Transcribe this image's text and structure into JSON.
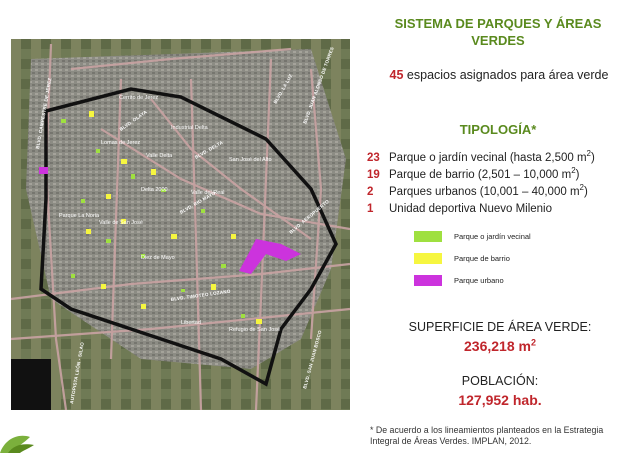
{
  "title": "SISTEMA DE PARQUES Y ÁREAS VERDES",
  "spaces": {
    "count": "45",
    "text": "espacios asignados para área verde"
  },
  "tipologia_title": "TIPOLOGÍA*",
  "types": [
    {
      "count": "23",
      "label": "Parque o jardín vecinal (hasta 2,500 m",
      "sup": "2",
      "close": ")"
    },
    {
      "count": "19",
      "label": "Parque de barrio (2,501 – 10,000 m",
      "sup": "2",
      "close": ")"
    },
    {
      "count": "2",
      "label": "Parques urbanos (10,001 – 40,000 m",
      "sup": "2",
      "close": ")"
    },
    {
      "count": "1",
      "label": "Unidad deportiva Nuevo Milenio",
      "sup": "",
      "close": ""
    }
  ],
  "legend": [
    {
      "label": "Parque o jardín vecinal",
      "color": "#9fe040"
    },
    {
      "label": "Parque de barrio",
      "color": "#f6f640"
    },
    {
      "label": "Parque urbano",
      "color": "#cc33dd"
    }
  ],
  "surface": {
    "title": "SUPERFICIE DE ÁREA VERDE:",
    "value": "236,218 m",
    "sup": "2"
  },
  "population": {
    "title": "POBLACIÓN:",
    "value": "127,952 hab."
  },
  "footnote": "* De acuerdo a los lineamientos planteados en la Estrategia Integral de Áreas Verdes. IMPLAN, 2012.",
  "map": {
    "places": [
      {
        "name": "Cerrito de Jerez"
      },
      {
        "name": "Industrial Delta"
      },
      {
        "name": "Lomas de Jerez"
      },
      {
        "name": "Valle Delta"
      },
      {
        "name": "San José del Alto"
      },
      {
        "name": "Delta 2000"
      },
      {
        "name": "Valle del Real"
      },
      {
        "name": "Parque La Noria"
      },
      {
        "name": "Valle de San José"
      },
      {
        "name": "Diez de Mayo"
      },
      {
        "name": "Libertad"
      },
      {
        "name": "Refugio de San José"
      }
    ],
    "roads": [
      {
        "name": "BLVD. OLAYA"
      },
      {
        "name": "BLVD. DELTA"
      },
      {
        "name": "BLVD. RIO MAYO"
      },
      {
        "name": "BLVD. AEROPUERTO"
      },
      {
        "name": "BLVD. TIMOTEO LOZANO"
      },
      {
        "name": "BLVD. LA LUZ"
      },
      {
        "name": "BLVD. SAN JUAN BOSCO"
      },
      {
        "name": "BLVD. JUAN ALONSO DE TORRES"
      },
      {
        "name": "BLVD. CAMPESTRE DE JEREZ"
      },
      {
        "name": "AUTOPISTA LEÓN - SILAO"
      }
    ]
  }
}
